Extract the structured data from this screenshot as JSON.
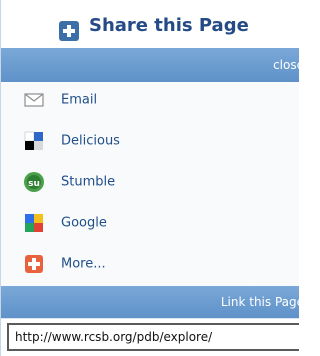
{
  "header": {
    "title": "Share this Page",
    "icon": "plus-square-icon",
    "colors": {
      "title": "#244b86",
      "icon": "#3c6fa8"
    }
  },
  "top_bar": {
    "label": "close",
    "colors": {
      "background": "#6f9fd1",
      "text": "#ffffff"
    }
  },
  "share_options": [
    {
      "label": "Email",
      "icon": "email-icon"
    },
    {
      "label": "Delicious",
      "icon": "delicious-icon"
    },
    {
      "label": "Stumble",
      "icon": "stumble-icon"
    },
    {
      "label": "Google",
      "icon": "google-icon"
    },
    {
      "label": "More...",
      "icon": "more-icon"
    }
  ],
  "link_bar": {
    "label": "Link this Page",
    "colors": {
      "background": "#6f9fd1",
      "text": "#ffffff"
    }
  },
  "link_field": {
    "value": "http://www.rcsb.org/pdb/explore/"
  }
}
